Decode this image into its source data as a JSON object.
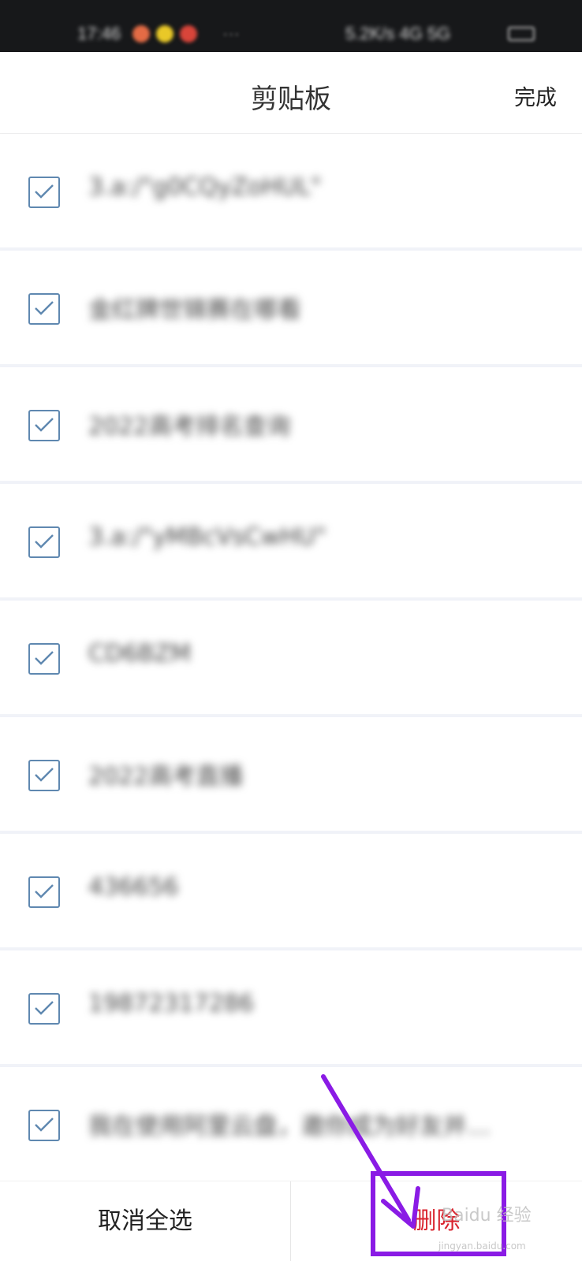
{
  "status_bar": {
    "time": "17:46",
    "dots": "···",
    "network": "5.2K/s 4G 5G",
    "notif_colors": [
      "#e46b45",
      "#e9c828",
      "#d9453a"
    ]
  },
  "header": {
    "title": "剪贴板",
    "done_label": "完成"
  },
  "clipboard_items": [
    {
      "text": "3.a:/\"g0CQyZoHUL\"",
      "checked": true
    },
    {
      "text": "金红牌世锦赛在哪看",
      "checked": true
    },
    {
      "text": "2022高考排名查询",
      "checked": true
    },
    {
      "text": "3.a:/\"yMBcVsCwHU\"",
      "checked": true
    },
    {
      "text": "CD6BZM",
      "checked": true
    },
    {
      "text": "2022高考直播",
      "checked": true
    },
    {
      "text": "436656",
      "checked": true
    },
    {
      "text": "19872317286",
      "checked": true
    },
    {
      "text": "我在使用阿里云盘，邀你成为好友并…",
      "checked": true
    }
  ],
  "bottom_bar": {
    "deselect_all_label": "取消全选",
    "delete_label": "删除"
  },
  "watermark": {
    "text": "Baidu 经验",
    "sub": "jingyan.baidu.com"
  },
  "colors": {
    "checkbox": "#5f88b0",
    "delete": "#d9232e",
    "annotation": "#8a1be5"
  }
}
